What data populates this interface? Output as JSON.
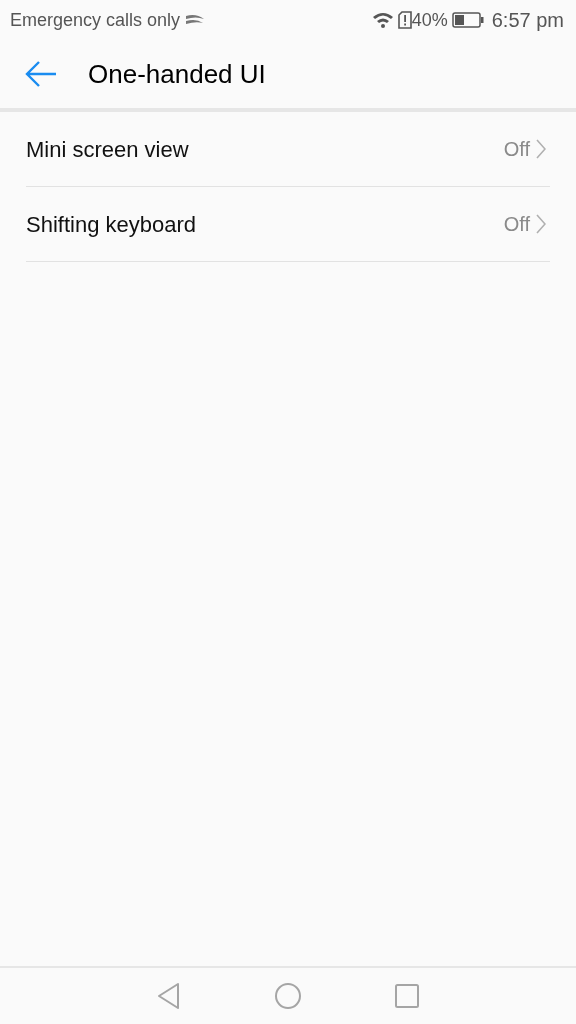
{
  "status_bar": {
    "carrier": "Emergency calls only",
    "battery": "40%",
    "time": "6:57 pm"
  },
  "header": {
    "title": "One-handed UI"
  },
  "settings": [
    {
      "label": "Mini screen view",
      "value": "Off"
    },
    {
      "label": "Shifting keyboard",
      "value": "Off"
    }
  ]
}
